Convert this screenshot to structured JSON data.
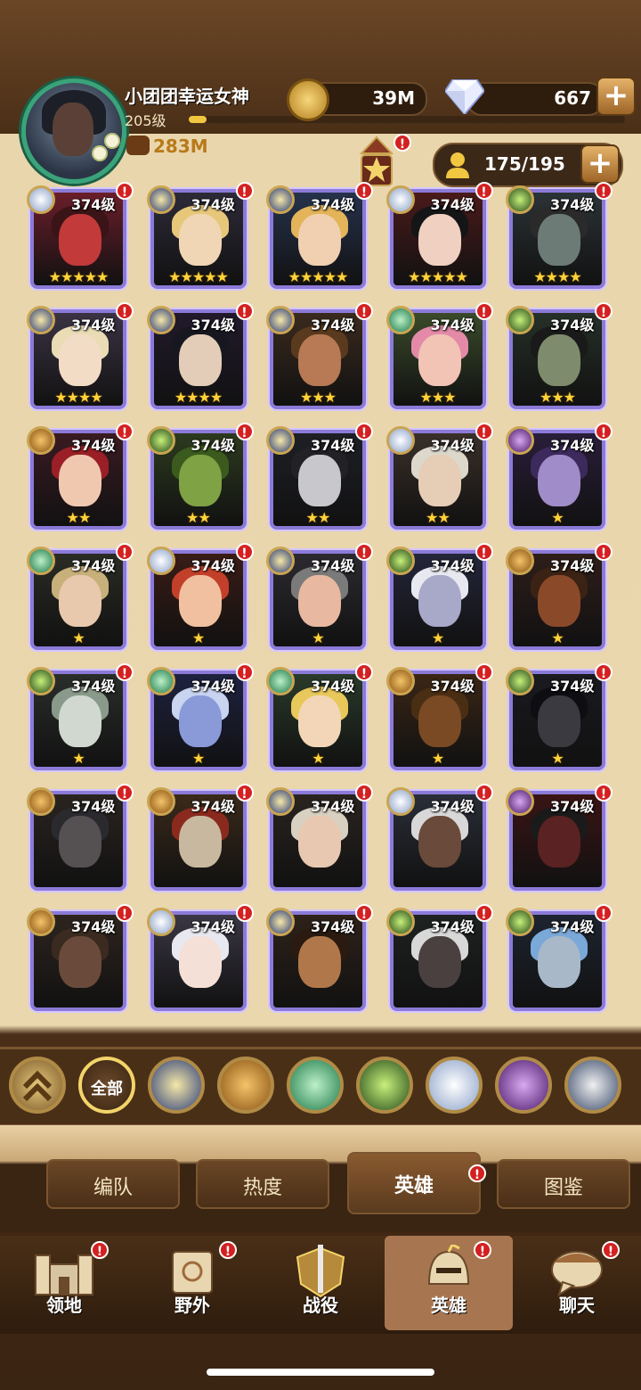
{
  "player": {
    "name": "小团团幸运女神",
    "level": "205级",
    "power": "283M",
    "xp_fraction": 0.04
  },
  "resources": {
    "gold": "39M",
    "diamonds": "667"
  },
  "hero_count": "175/195",
  "colors": {
    "accent": "#d42020",
    "frame": "#8c7ad8",
    "star": "#ffd23a",
    "gold": "#f1c641"
  },
  "heroes": [
    {
      "level": "374级",
      "stars": "★★★★★",
      "faction": "celestial",
      "art": "#6a1e2a",
      "skin": "#c23a3a",
      "hair": "#3a1416"
    },
    {
      "level": "374级",
      "stars": "★★★★★",
      "faction": "lightbearer",
      "art": "#2d2a38",
      "skin": "#f0d6b5",
      "hair": "#e7c77a"
    },
    {
      "level": "374级",
      "stars": "★★★★★",
      "faction": "lightbearer",
      "art": "#26324c",
      "skin": "#f0d0b0",
      "hair": "#e3b45a"
    },
    {
      "level": "374级",
      "stars": "★★★★★",
      "faction": "celestial",
      "art": "#4a1a1a",
      "skin": "#f0d0c0",
      "hair": "#151517"
    },
    {
      "level": "374级",
      "stars": "★★★★",
      "faction": "maulers",
      "art": "#2c3336",
      "skin": "#6d7b76",
      "hair": "#2a2a2a"
    },
    {
      "level": "374级",
      "stars": "★★★★",
      "faction": "lightbearer",
      "art": "#3b3344",
      "skin": "#f3dcc5",
      "hair": "#eadcb5"
    },
    {
      "level": "374级",
      "stars": "★★★★",
      "faction": "lightbearer",
      "art": "#221a2c",
      "skin": "#e4cdb8",
      "hair": "#171720"
    },
    {
      "level": "374级",
      "stars": "★★★",
      "faction": "lightbearer",
      "art": "#3a2a1e",
      "skin": "#b77a54",
      "hair": "#5a3a1e"
    },
    {
      "level": "374级",
      "stars": "★★★",
      "faction": "wilder",
      "art": "#3a4a2a",
      "skin": "#f1c4b6",
      "hair": "#e48aa8"
    },
    {
      "level": "374级",
      "stars": "★★★",
      "faction": "maulers",
      "art": "#263028",
      "skin": "#7e8c6d",
      "hair": "#1a1a1a"
    },
    {
      "level": "374级",
      "stars": "★★",
      "faction": "graveborn",
      "art": "#3a1b22",
      "skin": "#f0c8b0",
      "hair": "#9a1f26"
    },
    {
      "level": "374级",
      "stars": "★★",
      "faction": "maulers",
      "art": "#2d3a1e",
      "skin": "#7ea244",
      "hair": "#3b5a1e"
    },
    {
      "level": "374级",
      "stars": "★★",
      "faction": "lightbearer",
      "art": "#1e2026",
      "skin": "#c8c8cc",
      "hair": "#222226"
    },
    {
      "level": "374级",
      "stars": "★★",
      "faction": "celestial",
      "art": "#3a302a",
      "skin": "#e6cdb5",
      "hair": "#dcd8cc"
    },
    {
      "level": "374级",
      "stars": "★",
      "faction": "hypogean",
      "art": "#2a1e3a",
      "skin": "#a08cc8",
      "hair": "#3c2a5c"
    },
    {
      "level": "374级",
      "stars": "★",
      "faction": "wilder",
      "art": "#2a2c24",
      "skin": "#e8c9ad",
      "hair": "#c8b07a"
    },
    {
      "level": "374级",
      "stars": "★",
      "faction": "celestial",
      "art": "#3a1c16",
      "skin": "#f0c0a0",
      "hair": "#c2402a"
    },
    {
      "level": "374级",
      "stars": "★",
      "faction": "lightbearer",
      "art": "#2c2a30",
      "skin": "#e8b8a0",
      "hair": "#7a7a7a"
    },
    {
      "level": "374级",
      "stars": "★",
      "faction": "maulers",
      "art": "#24263a",
      "skin": "#a8a8c8",
      "hair": "#e8e8f0"
    },
    {
      "level": "374级",
      "stars": "★",
      "faction": "graveborn",
      "art": "#2e1e1a",
      "skin": "#8a4a2a",
      "hair": "#3a2214"
    },
    {
      "level": "374级",
      "stars": "★",
      "faction": "maulers",
      "art": "#2a2e2a",
      "skin": "#d0d8d0",
      "hair": "#8a9a8a"
    },
    {
      "level": "374级",
      "stars": "★",
      "faction": "wilder",
      "art": "#1e2240",
      "skin": "#8a9ad8",
      "hair": "#c8d4f0"
    },
    {
      "level": "374级",
      "stars": "★",
      "faction": "wilder",
      "art": "#2a3a2a",
      "skin": "#f3d6b8",
      "hair": "#e8c85a"
    },
    {
      "level": "374级",
      "stars": "★",
      "faction": "graveborn",
      "art": "#3a2616",
      "skin": "#7a4a24",
      "hair": "#4a2e14"
    },
    {
      "level": "374级",
      "stars": "★",
      "faction": "maulers",
      "art": "#1a1a20",
      "skin": "#3a3a40",
      "hair": "#0e0e12"
    },
    {
      "level": "374级",
      "stars": "",
      "faction": "graveborn",
      "art": "#2a2420",
      "skin": "#555052",
      "hair": "#2a2a2e"
    },
    {
      "level": "374级",
      "stars": "",
      "faction": "graveborn",
      "art": "#3a2a1a",
      "skin": "#c8b8a0",
      "hair": "#8a2a1e"
    },
    {
      "level": "374级",
      "stars": "",
      "faction": "lightbearer",
      "art": "#2a2420",
      "skin": "#e8c8b0",
      "hair": "#d8d0c0"
    },
    {
      "level": "374级",
      "stars": "",
      "faction": "celestial",
      "art": "#2a2e38",
      "skin": "#6a4a3a",
      "hair": "#d8d8d8"
    },
    {
      "level": "374级",
      "stars": "",
      "faction": "hypogean",
      "art": "#3a1414",
      "skin": "#5a2222",
      "hair": "#1a1a1a"
    },
    {
      "level": "374级",
      "stars": "",
      "faction": "graveborn",
      "art": "#2e241e",
      "skin": "#6a4a3a",
      "hair": "#3a2a20"
    },
    {
      "level": "374级",
      "stars": "",
      "faction": "celestial",
      "art": "#3a3644",
      "skin": "#f4e0d6",
      "hair": "#e8e8f0"
    },
    {
      "level": "374级",
      "stars": "",
      "faction": "lightbearer",
      "art": "#2e221a",
      "skin": "#b0784a",
      "hair": "#2a1a10"
    },
    {
      "level": "374级",
      "stars": "",
      "faction": "maulers",
      "art": "#1e2220",
      "skin": "#4a4040",
      "hair": "#d8d8d8"
    },
    {
      "level": "374级",
      "stars": "",
      "faction": "maulers",
      "art": "#1e2430",
      "skin": "#a8b8c8",
      "hair": "#7aa8d8"
    }
  ],
  "faction_filters": [
    {
      "name": "collapse",
      "label": ""
    },
    {
      "name": "all",
      "label": "全部"
    },
    {
      "name": "lightbearer",
      "label": ""
    },
    {
      "name": "graveborn",
      "label": ""
    },
    {
      "name": "wilder",
      "label": ""
    },
    {
      "name": "maulers",
      "label": ""
    },
    {
      "name": "celestial",
      "label": ""
    },
    {
      "name": "hypogean",
      "label": ""
    },
    {
      "name": "dimensional",
      "label": ""
    }
  ],
  "sub_tabs": [
    "编队",
    "热度",
    "英雄",
    "图鉴"
  ],
  "bottom_nav": [
    "领地",
    "野外",
    "战役",
    "英雄",
    "聊天"
  ]
}
